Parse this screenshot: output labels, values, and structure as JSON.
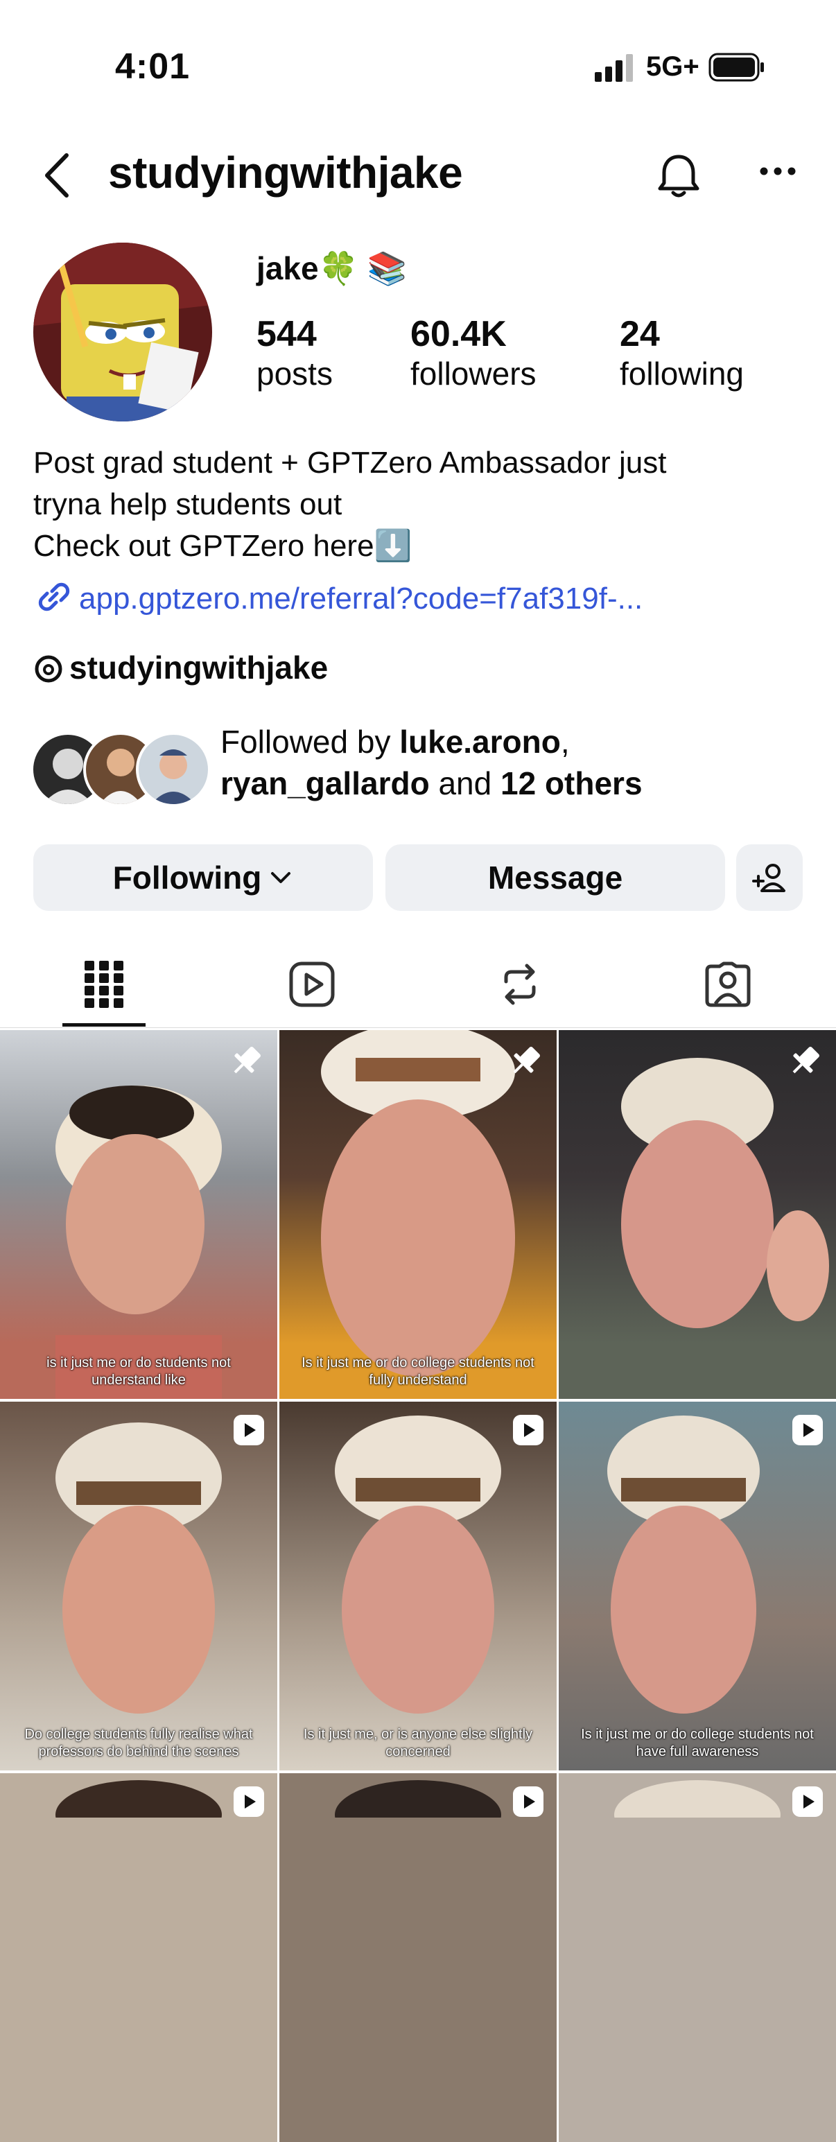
{
  "status_bar": {
    "time": "4:01",
    "network": "5G+"
  },
  "header": {
    "username": "studyingwithjake"
  },
  "profile": {
    "display_name": "jake🍀 📚",
    "stats": {
      "posts": {
        "value": "544",
        "label": "posts"
      },
      "followers": {
        "value": "60.4K",
        "label": "followers"
      },
      "following": {
        "value": "24",
        "label": "following"
      }
    },
    "bio_lines": [
      "Post grad student + GPTZero Ambassador just",
      "tryna help students out",
      "Check out GPTZero here⬇️"
    ],
    "link": "app.gptzero.me/referral?code=f7af319f-...",
    "threads_handle": "studyingwithjake",
    "followed_by": {
      "prefix": "Followed by ",
      "name1": "luke.arono",
      "sep": ",",
      "name2": "ryan_gallardo",
      "and": " and ",
      "others": "12 others"
    }
  },
  "actions": {
    "following_label": "Following",
    "message_label": "Message"
  },
  "tabs": [
    "grid",
    "reels",
    "reposts",
    "tagged"
  ],
  "posts": [
    {
      "type": "pinned",
      "caption": "is it just me or do students not understand like"
    },
    {
      "type": "pinned",
      "caption": "Is it just me or do college students not fully understand"
    },
    {
      "type": "pinned",
      "caption": ""
    },
    {
      "type": "reel",
      "caption": "Do college students fully realise what professors do behind the scenes"
    },
    {
      "type": "reel",
      "caption": "Is it just me, or is anyone else slightly concerned"
    },
    {
      "type": "reel",
      "caption": "Is it just me or do college students not have full awareness"
    },
    {
      "type": "reel",
      "caption": ""
    },
    {
      "type": "reel",
      "caption": ""
    },
    {
      "type": "reel",
      "caption": ""
    }
  ],
  "colors": {
    "link": "#3556d8",
    "button_bg": "#eef0f3"
  }
}
